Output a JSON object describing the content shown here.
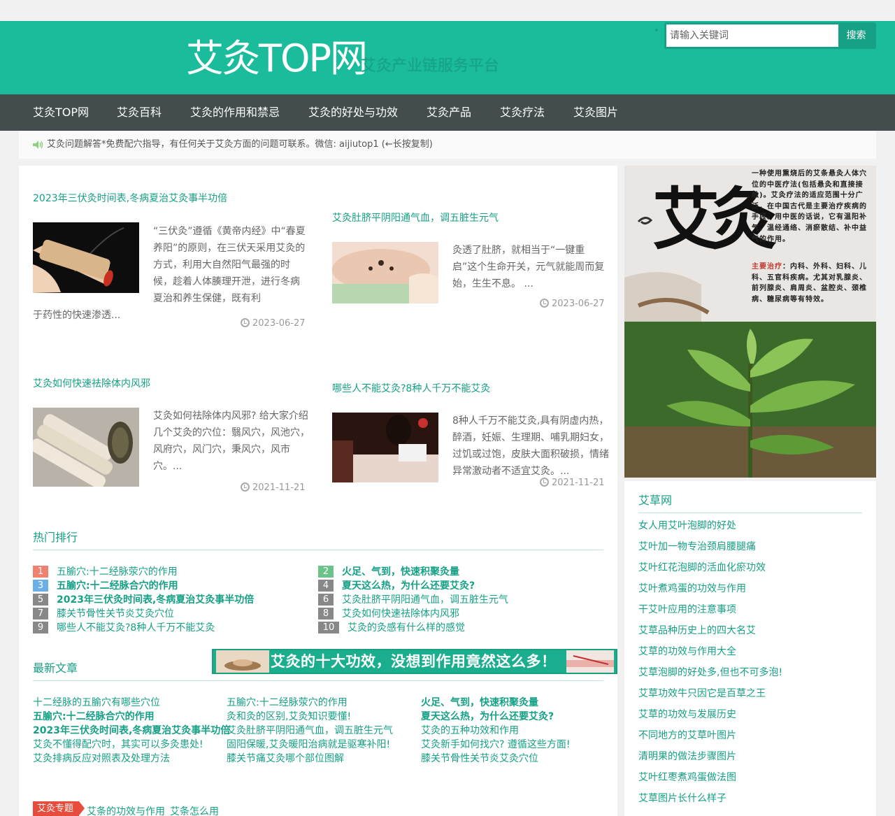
{
  "header": {
    "logo": "艾灸TOP网",
    "slogan": "艾灸产业链服务平台",
    "search_placeholder": "请输入关键词",
    "search_button": "搜索"
  },
  "nav": [
    "艾灸TOP网",
    "艾灸百科",
    "艾灸的作用和禁忌",
    "艾灸的好处与功效",
    "艾灸产品",
    "艾灸疗法",
    "艾灸图片"
  ],
  "notice": "艾灸问题解答*免费配穴指导，有任何关于艾灸方面的问题可联系。微信: aijiutop1 (←长按复制)",
  "posts": [
    {
      "title": "2023年三伏灸时间表,冬病夏治艾灸事半功倍",
      "excerpt": "“三伏灸”遵循《黄帝内经》中“春夏养阳”的原则，在三伏天采用艾灸的方式，利用大自然阳气最强的时候，趁着人体腠理开泄，进行冬病夏治和养生保健，既有利于药性的快速渗透...",
      "date": "2023-06-27"
    },
    {
      "title": "艾灸肚脐平阴阳通气血，调五脏生元气",
      "excerpt": "灸透了肚脐，就相当于“一键重启”这个生命开关，元气就能周而复始，生生不息。 ...",
      "date": "2023-06-27"
    },
    {
      "title": "艾灸如何快速祛除体内风邪",
      "excerpt": "艾灸如何祛除体内风邪? 给大家介绍几个艾灸的穴位：翳风穴，风池穴，风府穴，风门穴，秉风穴，风市穴。...",
      "date": "2021-11-21"
    },
    {
      "title": "哪些人不能艾灸?8种人千万不能艾灸",
      "excerpt": "8种人千万不能艾灸,具有阴虚内热，醉酒，妊娠、生理期、哺乳期妇女，过饥或过饱，皮肤大面积破损，情绪异常激动者不适宜艾灸。...",
      "date": "2021-11-21"
    }
  ],
  "hot": {
    "title": "热门排行",
    "items": [
      {
        "num": "1",
        "label": "五腧穴:十二经脉荥穴的作用",
        "bold": false,
        "color": "#f08070"
      },
      {
        "num": "2",
        "label": "火足、气到，快速积聚灸量",
        "bold": true,
        "color": "#6cc38a"
      },
      {
        "num": "3",
        "label": "五腧穴:十二经脉合穴的作用",
        "bold": true,
        "color": "#6ab0e8"
      },
      {
        "num": "4",
        "label": "夏天这么热，为什么还要艾灸?",
        "bold": true,
        "color": "#888888"
      },
      {
        "num": "5",
        "label": "2023年三伏灸时间表,冬病夏治艾灸事半功倍",
        "bold": true,
        "color": "#888888"
      },
      {
        "num": "6",
        "label": "艾灸肚脐平阴阳通气血，调五脏生元气",
        "bold": false,
        "color": "#888888"
      },
      {
        "num": "7",
        "label": "膝关节骨性关节炎艾灸穴位",
        "bold": false,
        "color": "#888888"
      },
      {
        "num": "8",
        "label": "艾灸如何快速祛除体内风邪",
        "bold": false,
        "color": "#888888"
      },
      {
        "num": "9",
        "label": "哪些人不能艾灸?8种人千万不能艾灸",
        "bold": false,
        "color": "#888888"
      },
      {
        "num": "10",
        "label": "艾灸的灸感有什么样的感觉",
        "bold": false,
        "color": "#888888"
      }
    ]
  },
  "latest": {
    "title": "最新文章",
    "banner": "艾灸的十大功效，没想到作用竟然这么多！",
    "columns": [
      [
        {
          "label": "十二经脉的五腧穴有哪些穴位",
          "bold": false
        },
        {
          "label": "五腧穴:十二经脉合穴的作用",
          "bold": true
        },
        {
          "label": "2023年三伏灸时间表,冬病夏治艾灸事半功倍",
          "bold": true
        },
        {
          "label": "艾灸不懂得配穴时，其实可以多灸患处!",
          "bold": false
        },
        {
          "label": "艾灸排病反应对照表及处理方法",
          "bold": false
        }
      ],
      [
        {
          "label": "五腧穴:十二经脉荥穴的作用",
          "bold": false
        },
        {
          "label": "灸和灸的区别,艾灸知识要懂!",
          "bold": false
        },
        {
          "label": "艾灸肚脐平阴阳通气血，调五脏生元气",
          "bold": false
        },
        {
          "label": "固阳保暖,艾灸暖阳治病就是驱寒补阳!",
          "bold": false
        },
        {
          "label": "膝关节痛艾灸哪个部位图解",
          "bold": false
        }
      ],
      [
        {
          "label": "火足、气到，快速积聚灸量",
          "bold": true
        },
        {
          "label": "夏天这么热，为什么还要艾灸?",
          "bold": true
        },
        {
          "label": "艾灸的五种功效和作用",
          "bold": false
        },
        {
          "label": "艾灸新手如何找穴? 遵循这些方面!",
          "bold": false
        },
        {
          "label": "膝关节骨性关节炎艾灸穴位",
          "bold": false
        }
      ]
    ]
  },
  "topic": {
    "tag": "艾灸专题",
    "links": [
      "艾条的功效与作用",
      "艾条怎么用"
    ]
  },
  "sidebar": {
    "poster_title": "艾灸",
    "poster_text": "一种使用熏烧后的艾条悬灸人体穴位的中医疗法(包括悬灸和直接接触)。艾灸疗法的适应范围十分广泛，在中国古代是主要治疗疾病的手段。用中医的话说，它有温阳补气、温经通络、消瘀散结、补中益气的作用。",
    "poster_sub_label": "主要治疗",
    "poster_sub_text": "：内科、外科、妇科、儿科、五官科疾病。尤其对乳腺炎、前列腺炎、肩周炎、盆腔炎、颈椎病、糖尿病等有特效。",
    "title": "艾草网",
    "items": [
      "女人用艾叶泡脚的好处",
      "艾叶加一物专治颈肩腰腿痛",
      "艾叶红花泡脚的活血化瘀功效",
      "艾叶煮鸡蛋的功效与作用",
      "干艾叶应用的注意事项",
      "艾草品种历史上的四大名艾",
      "艾草的功效与作用大全",
      "艾草泡脚的好处多,但也不可多泡!",
      "艾草功效牛只因它是百草之王",
      "艾草的功效与发展历史",
      "不同地方的艾草叶图片",
      "清明果的做法步骤图片",
      "艾叶红枣煮鸡蛋做法图",
      "艾草图片长什么样子"
    ]
  }
}
